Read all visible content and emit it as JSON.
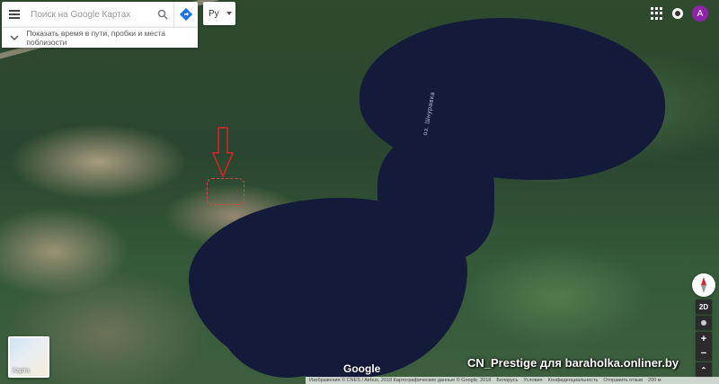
{
  "search": {
    "placeholder": "Поиск на Google Картах"
  },
  "travel": {
    "text": "Показать время в пути, пробки и места поблизости"
  },
  "language": {
    "selected": "Ру"
  },
  "account": {
    "initial": "A",
    "color": "#8e24aa"
  },
  "map": {
    "lake_label": "оз. Шнуравка"
  },
  "layer": {
    "label": "Карта"
  },
  "controls": {
    "view_mode": "2D",
    "zoom_in": "+",
    "zoom_out": "−",
    "expand": "⌃"
  },
  "branding": {
    "logo": "Google"
  },
  "watermark": {
    "text": "CN_Prestige для baraholka.onliner.by"
  },
  "footer": {
    "imagery": "Изображения © CNES / Airbus, 2018 Картографические данные © Google, 2018",
    "country": "Беларусь",
    "terms": "Условия",
    "privacy": "Конфиденциальность",
    "feedback": "Отправить отзыв",
    "scale": "200 м"
  }
}
